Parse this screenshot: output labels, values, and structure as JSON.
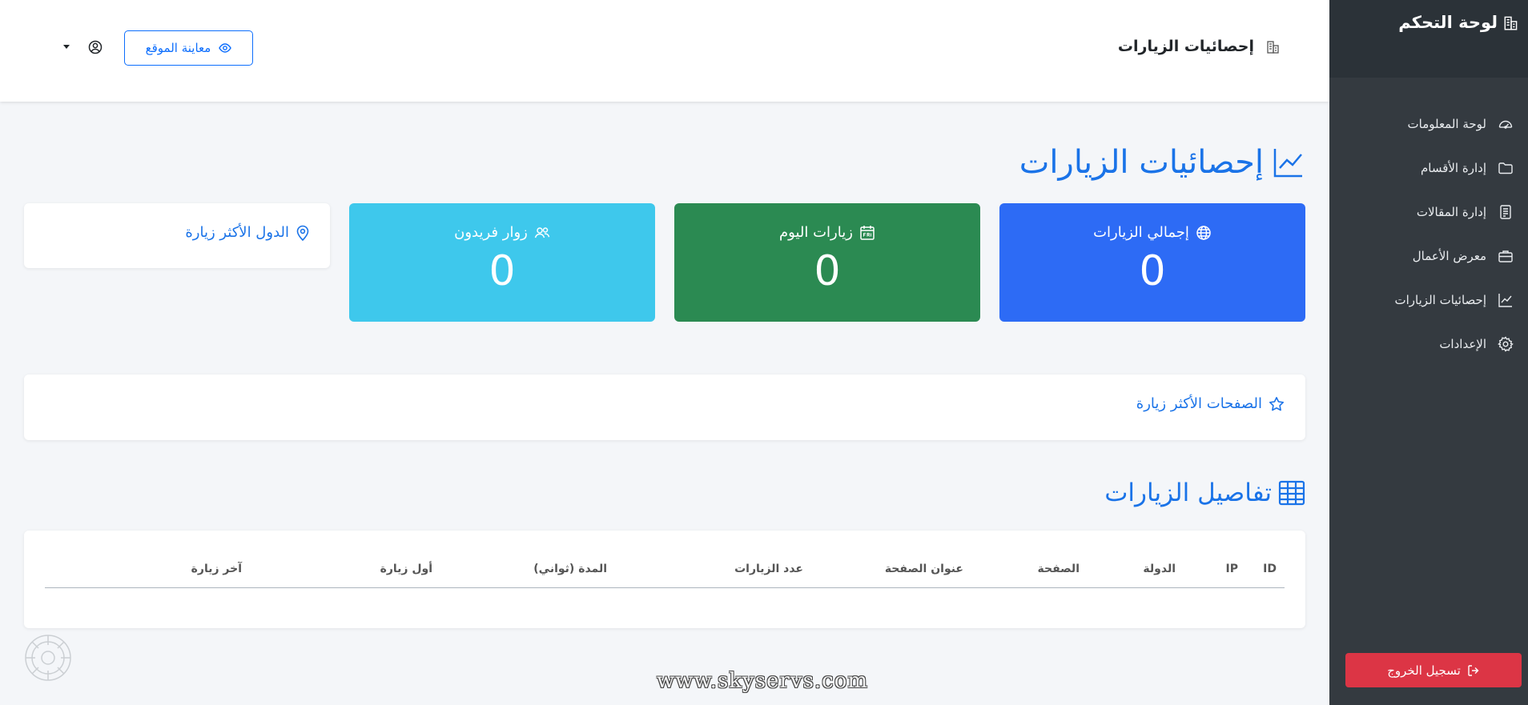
{
  "sidebar": {
    "brand_title": "لوحة التحكم",
    "brand_subtitle": "",
    "items": [
      {
        "label": "لوحة المعلومات",
        "icon": "dashboard-icon"
      },
      {
        "label": "إدارة الأقسام",
        "icon": "folder-icon"
      },
      {
        "label": "إدارة المقالات",
        "icon": "document-icon"
      },
      {
        "label": "معرض الأعمال",
        "icon": "briefcase-icon"
      },
      {
        "label": "إحصائيات الزيارات",
        "icon": "chart-line-icon"
      },
      {
        "label": "الإعدادات",
        "icon": "gear-icon"
      }
    ],
    "logout_label": "تسجيل الخروج"
  },
  "topbar": {
    "title": "إحصائيات الزيارات",
    "preview_label": "معاينة الموقع"
  },
  "main": {
    "page_title": "إحصائيات الزيارات",
    "cards": {
      "total": {
        "label": "إجمالي الزيارات",
        "value": "0",
        "color": "#2d6bf5"
      },
      "today": {
        "label": "زيارات اليوم",
        "value": "0",
        "color": "#2b8a52"
      },
      "unique": {
        "label": "زوار فريدون",
        "value": "0",
        "color": "#3ec8ec"
      },
      "countries": {
        "label": "الدول الأكثر زيارة"
      }
    },
    "top_pages_label": "الصفحات الأكثر زيارة",
    "details_title": "تفاصيل الزيارات",
    "table_headers": [
      "ID",
      "IP",
      "الدولة",
      "الصفحة",
      "عنوان الصفحة",
      "عدد الزيارات",
      "المدة (ثواني)",
      "أول زيارة",
      "آخر زيارة"
    ]
  },
  "watermark": "www.skyservs.com",
  "colors": {
    "accent": "#1a73e8",
    "sidebar": "#343a40",
    "danger": "#dc3545"
  }
}
